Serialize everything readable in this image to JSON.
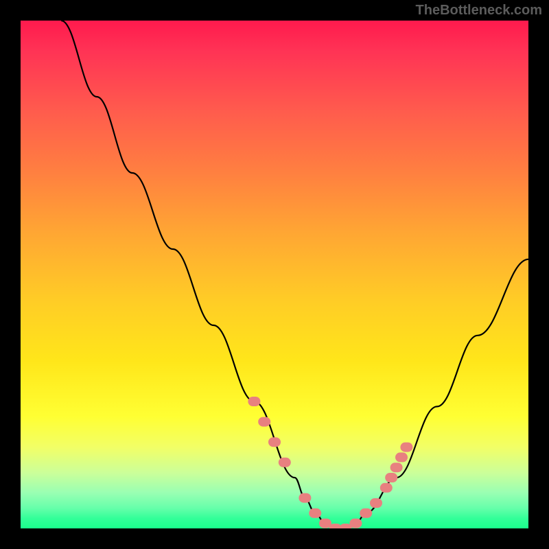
{
  "watermark": "TheBottleneck.com",
  "chart_data": {
    "type": "line",
    "title": "",
    "xlabel": "",
    "ylabel": "",
    "xlim": [
      0,
      100
    ],
    "ylim": [
      0,
      100
    ],
    "series": [
      {
        "name": "bottleneck-curve",
        "x": [
          8,
          15,
          22,
          30,
          38,
          46,
          54,
          56,
          58,
          60,
          62,
          64,
          66,
          68,
          74,
          82,
          90,
          100
        ],
        "y": [
          100,
          85,
          70,
          55,
          40,
          25,
          10,
          6,
          3,
          1,
          0,
          0,
          1,
          3,
          10,
          24,
          38,
          53
        ]
      }
    ],
    "markers": [
      {
        "name": "highlight-dots",
        "color": "#e88080",
        "points_x": [
          46,
          48,
          50,
          52,
          56,
          58,
          60,
          62,
          64,
          66,
          68,
          70,
          72,
          73,
          74,
          75,
          76
        ],
        "points_y": [
          25,
          21,
          17,
          13,
          6,
          3,
          1,
          0,
          0,
          1,
          3,
          5,
          8,
          10,
          12,
          14,
          16
        ]
      }
    ],
    "gradient_stops": [
      {
        "pos": 0,
        "color": "#ff1a4d"
      },
      {
        "pos": 50,
        "color": "#ffcc26"
      },
      {
        "pos": 80,
        "color": "#ffff33"
      },
      {
        "pos": 100,
        "color": "#1aff8c"
      }
    ]
  }
}
